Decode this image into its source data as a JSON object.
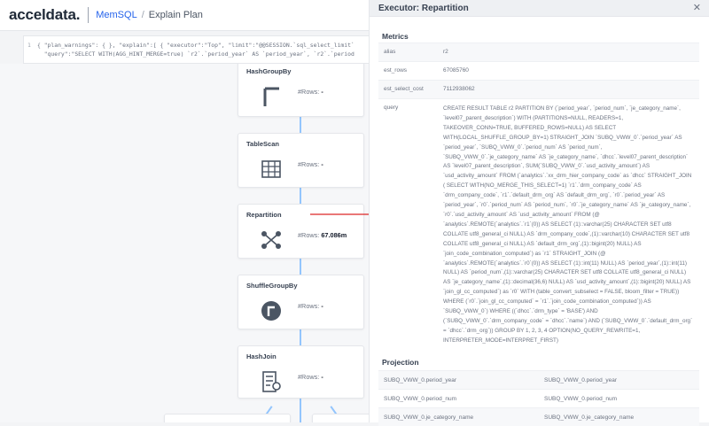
{
  "header": {
    "brand": "acceldata.",
    "breadcrumb": {
      "root": "MemSQL",
      "divider": "/",
      "current": "Explain Plan"
    }
  },
  "json_preview": {
    "gutter": "1",
    "lines": [
      "{ \"plan_warnings\": { }, \"explain\":[ { \"executor\":\"Top\", \"limit\":\"@@SESSION.`sql_select_limit`",
      "  \"query\":\"SELECT WITH(AGG_HINT_MERGE=true) `r2`.`period_year` AS `period_year`, `r2`.`period"
    ]
  },
  "plan": {
    "rows_label": "#Rows:",
    "nodes": [
      {
        "title": "HashGroupBy",
        "rows": "-",
        "icon": "hashgroupby-icon"
      },
      {
        "title": "TableScan",
        "rows": "-",
        "icon": "table-icon"
      },
      {
        "title": "Repartition",
        "rows": "67.086m",
        "icon": "repartition-icon"
      },
      {
        "title": "ShuffleGroupBy",
        "rows": "-",
        "icon": "shufflegroupby-icon"
      },
      {
        "title": "HashJoin",
        "rows": "-",
        "icon": "hashjoin-icon"
      }
    ],
    "accent": "#2563eb",
    "edge_color": "#93c5fd",
    "arrow_color": "#dc2626"
  },
  "panel": {
    "title": "Executor: Repartition",
    "close_icon": "close-icon",
    "metrics_title": "Metrics",
    "metrics": [
      {
        "key": "alias",
        "value": "r2"
      },
      {
        "key": "est_rows",
        "value": "67085760"
      },
      {
        "key": "est_select_cost",
        "value": "7112938062"
      }
    ],
    "query_key": "query",
    "query_value": "CREATE RESULT TABLE r2 PARTITION BY (`period_year`, `period_num`, `je_category_name`, `level07_parent_description`) WITH (PARTITIONS=NULL, READERS=1, TAKEOVER_CONN=TRUE, BUFFERED_ROWS=NULL) AS SELECT WITH(LOCAL_SHUFFLE_GROUP_BY=1) STRAIGHT_JOIN `SUBQ_VWW_0`.`period_year` AS `period_year`, `SUBQ_VWW_0`.`period_num` AS `period_num`, `SUBQ_VWW_0`.`je_category_name` AS `je_category_name`, `dhcc`.`level07_parent_description` AS `level07_parent_description`, SUM(`SUBQ_VWW_0`.`usd_activity_amount`) AS `usd_activity_amount` FROM (`analytics`.`xx_drm_hier_company_code` as `dhcc` STRAIGHT_JOIN ( SELECT WITH(NO_MERGE_THIS_SELECT=1) `r1`.`drm_company_code` AS `drm_company_code`, `r1`.`default_drm_org` AS `default_drm_org`, `r0`.`period_year` AS `period_year`, `r0`.`period_num` AS `period_num`, `r0`.`je_category_name` AS `je_category_name`, `r0`.`usd_activity_amount` AS `usd_activity_amount` FROM (@ `analytics`.REMOTE(`analytics`.`r1`(0)) AS SELECT (1)::varchar(25) CHARACTER SET utf8 COLLATE utf8_general_ci NULL) AS `drm_company_code`,(1)::varchar(10) CHARACTER SET utf8 COLLATE utf8_general_ci NULL) AS `default_drm_org`,(1)::bigint(20) NULL) AS `join_code_combination_computed`) as `r1` STRAIGHT_JOIN (@ `analytics`.REMOTE(`analytics`.`r0`(0)) AS SELECT (1)::int(11) NULL) AS `period_year`,(1)::int(11) NULL) AS `period_num`,(1)::varchar(25) CHARACTER SET utf8 COLLATE utf8_general_ci NULL) AS `je_category_name`,(1)::decimal(36,6) NULL) AS `usd_activity_amount`,(1)::bigint(20) NULL) AS `join_gl_cc_computed`) as `r0` WITH (table_convert_subselect = FALSE, bloom_filter = TRUE)) WHERE (`r0`.`join_gl_cc_computed` = `r1`.`join_code_combination_computed`)) AS `SUBQ_VWW_0`) WHERE ((`dhcc`.`drm_type` = 'BASE') AND (`SUBQ_VWW_0`.`drm_company_code` = `dhcc`.`name`) AND (`SUBQ_VWW_0`.`default_drm_org` = `dhcc`.`drm_org`)) GROUP BY 1, 2, 3, 4 OPTION(NO_QUERY_REWRITE=1, INTERPRETER_MODE=INTERPRET_FIRST)",
    "projection_title": "Projection",
    "projection": [
      [
        "SUBQ_VWW_0.period_year",
        "SUBQ_VWW_0.period_year"
      ],
      [
        "SUBQ_VWW_0.period_num",
        "SUBQ_VWW_0.period_num"
      ],
      [
        "SUBQ_VWW_0.je_category_name",
        "SUBQ_VWW_0.je_category_name"
      ]
    ]
  }
}
